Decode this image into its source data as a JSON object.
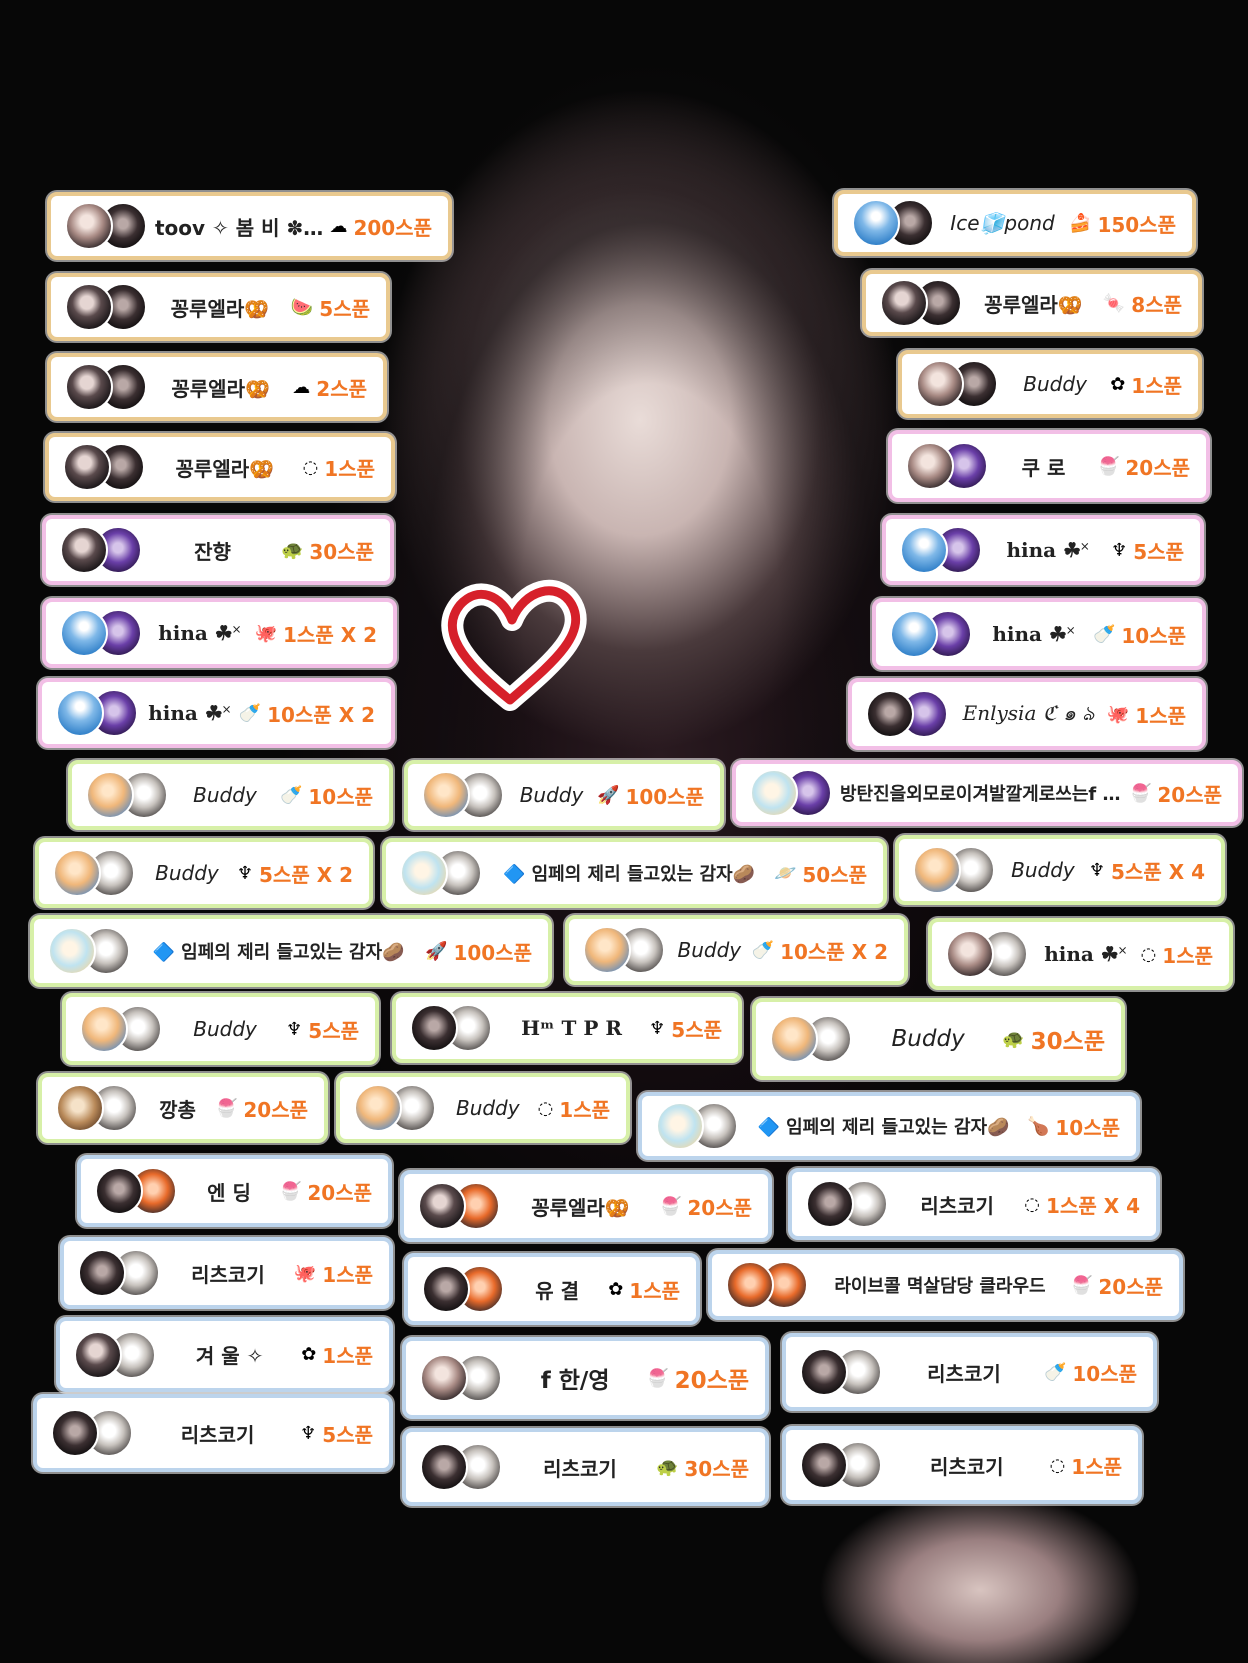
{
  "colors": {
    "accent_orange": "#f07524",
    "gold_border": "#e9c98f",
    "pink_border": "#f2bfe6",
    "green_border": "#d7f0a8",
    "blue_border": "#bcd4ec"
  },
  "badges": [
    {
      "name": "toov ✧ 봄 비 ✽.:*",
      "gift": "gift-cloud-icon",
      "glyph": "☁",
      "amount": "200스푼"
    },
    {
      "name": "Ice🧊pond",
      "gift": "gift-cake-icon",
      "glyph": "🍰",
      "amount": "150스푼"
    },
    {
      "name": "꽁루엘라🥨",
      "gift": "gift-watermelon-icon",
      "glyph": "🍉",
      "amount": "5스푼"
    },
    {
      "name": "꽁루엘라🥨",
      "gift": "gift-candy-icon",
      "glyph": "🍬",
      "amount": "8스푼"
    },
    {
      "name": "꽁루엘라🥨",
      "gift": "gift-cloud-icon",
      "glyph": "☁",
      "amount": "2스푼"
    },
    {
      "name": "Buddy",
      "gift": "gift-flower-icon",
      "glyph": "✿",
      "amount": "1스푼"
    },
    {
      "name": "꽁루엘라🥨",
      "gift": "gift-bowl-icon",
      "glyph": "◌",
      "amount": "1스푼"
    },
    {
      "name": "쿠 로",
      "gift": "gift-shaved-ice-icon",
      "glyph": "🍧",
      "amount": "20스푼"
    },
    {
      "name": "잔향",
      "gift": "gift-turtle-icon",
      "glyph": "🐢",
      "amount": "30스푼"
    },
    {
      "name": "hina ☘˟",
      "gift": "gift-seahorse-icon",
      "glyph": "♆",
      "amount": "5스푼"
    },
    {
      "name": "hina ☘˟",
      "gift": "gift-octopus-icon",
      "glyph": "🐙",
      "amount": "1스푼 X 2"
    },
    {
      "name": "hina ☘˟",
      "gift": "gift-bottle-icon",
      "glyph": "🍼",
      "amount": "10스푼"
    },
    {
      "name": "hina ☘˟",
      "gift": "gift-bottle-icon",
      "glyph": "🍼",
      "amount": "10스푼 X 2"
    },
    {
      "name": "Enlysia ℭ ๑ ঌ",
      "gift": "gift-octopus-icon",
      "glyph": "🐙",
      "amount": "1스푼"
    },
    {
      "name": "Buddy",
      "gift": "gift-bottle-icon",
      "glyph": "🍼",
      "amount": "10스푼"
    },
    {
      "name": "Buddy",
      "gift": "gift-rocket-icon",
      "glyph": "🚀",
      "amount": "100스푼"
    },
    {
      "name": "방탄진을외모로이겨발깔게로쓰는f ...",
      "gift": "gift-shaved-ice-icon",
      "glyph": "🍧",
      "amount": "20스푼"
    },
    {
      "name": "Buddy",
      "gift": "gift-seahorse-icon",
      "glyph": "♆",
      "amount": "5스푼 X 2"
    },
    {
      "name": "🔷 임페의 제리 들고있는 감자🥔",
      "gift": "gift-planet-icon",
      "glyph": "🪐",
      "amount": "50스푼"
    },
    {
      "name": "Buddy",
      "gift": "gift-seahorse-icon",
      "glyph": "♆",
      "amount": "5스푼 X 4"
    },
    {
      "name": "🔷 임페의 제리 들고있는 감자🥔",
      "gift": "gift-rocket-icon",
      "glyph": "🚀",
      "amount": "100스푼"
    },
    {
      "name": "Buddy",
      "gift": "gift-bottle-icon",
      "glyph": "🍼",
      "amount": "10스푼 X 2"
    },
    {
      "name": "hina ☘˟",
      "gift": "gift-bowl-icon",
      "glyph": "◌",
      "amount": "1스푼"
    },
    {
      "name": "Buddy",
      "gift": "gift-seahorse-icon",
      "glyph": "♆",
      "amount": "5스푼"
    },
    {
      "name": "Hᵐ T P R",
      "gift": "gift-seahorse-icon",
      "glyph": "♆",
      "amount": "5스푼"
    },
    {
      "name": "Buddy",
      "gift": "gift-turtle-icon",
      "glyph": "🐢",
      "amount": "30스푼"
    },
    {
      "name": "깡총",
      "gift": "gift-shaved-ice-icon",
      "glyph": "🍧",
      "amount": "20스푼"
    },
    {
      "name": "Buddy",
      "gift": "gift-bowl-icon",
      "glyph": "◌",
      "amount": "1스푼"
    },
    {
      "name": "🔷 임페의 제리 들고있는 감자🥔",
      "gift": "gift-drumstick-icon",
      "glyph": "🍗",
      "amount": "10스푼"
    },
    {
      "name": "엔 딩",
      "gift": "gift-shaved-ice-icon",
      "glyph": "🍧",
      "amount": "20스푼"
    },
    {
      "name": "꽁루엘라🥨",
      "gift": "gift-shaved-ice-icon",
      "glyph": "🍧",
      "amount": "20스푼"
    },
    {
      "name": "리츠코기",
      "gift": "gift-bowl-icon",
      "glyph": "◌",
      "amount": "1스푼 X 4"
    },
    {
      "name": "리츠코기",
      "gift": "gift-octopus-icon",
      "glyph": "🐙",
      "amount": "1스푼"
    },
    {
      "name": "유 결",
      "gift": "gift-flower-icon",
      "glyph": "✿",
      "amount": "1스푼"
    },
    {
      "name": "라이브콜 멱살담당 클라우드",
      "gift": "gift-shaved-ice-icon",
      "glyph": "🍧",
      "amount": "20스푼"
    },
    {
      "name": "겨 울 ✧",
      "gift": "gift-flower-icon",
      "glyph": "✿",
      "amount": "1스푼"
    },
    {
      "name": "f 한/영",
      "gift": "gift-shaved-ice-icon",
      "glyph": "🍧",
      "amount": "20스푼"
    },
    {
      "name": "리츠코기",
      "gift": "gift-bottle-icon",
      "glyph": "🍼",
      "amount": "10스푼"
    },
    {
      "name": "리츠코기",
      "gift": "gift-seahorse-icon",
      "glyph": "♆",
      "amount": "5스푼"
    },
    {
      "name": "리츠코기",
      "gift": "gift-turtle-icon",
      "glyph": "🐢",
      "amount": "30스푼"
    },
    {
      "name": "리츠코기",
      "gift": "gift-bowl-icon",
      "glyph": "◌",
      "amount": "1스푼"
    }
  ]
}
